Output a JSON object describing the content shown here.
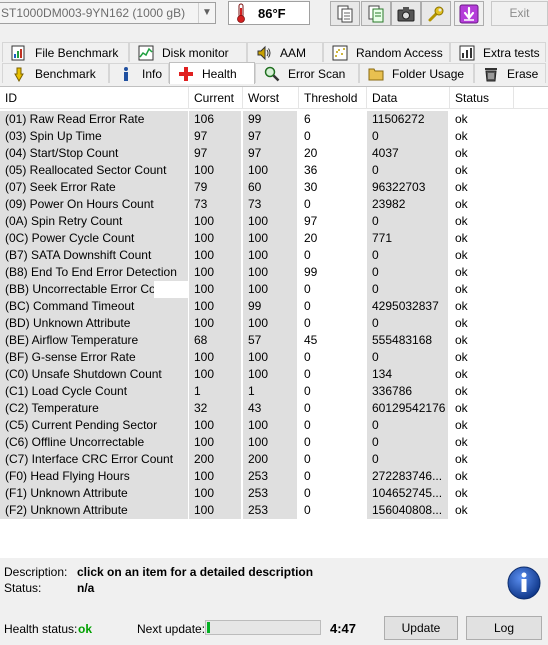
{
  "toolbar": {
    "drive": "ST1000DM003-9YN162 (1000 gB)",
    "temperature": "86°F",
    "exit_label": "Exit",
    "buttons": [
      "copy-icon",
      "copy-all-icon",
      "camera-icon",
      "wrench-icon",
      "download-icon"
    ],
    "colors": {
      "accent_purple": "#b43dd9",
      "thermo_red": "#d32020"
    }
  },
  "tabs_row1": [
    {
      "label": "File Benchmark",
      "icon": "file-benchmark-icon"
    },
    {
      "label": "Disk monitor",
      "icon": "disk-monitor-icon"
    },
    {
      "label": "AAM",
      "icon": "speaker-icon"
    },
    {
      "label": "Random Access",
      "icon": "random-access-icon"
    },
    {
      "label": "Extra tests",
      "icon": "extra-tests-icon"
    }
  ],
  "tabs_row2": [
    {
      "label": "Benchmark",
      "icon": "benchmark-icon"
    },
    {
      "label": "Info",
      "icon": "info-icon"
    },
    {
      "label": "Health",
      "icon": "health-icon",
      "active": true
    },
    {
      "label": "Error Scan",
      "icon": "magnifier-icon"
    },
    {
      "label": "Folder Usage",
      "icon": "folder-icon"
    },
    {
      "label": "Erase",
      "icon": "trash-icon"
    }
  ],
  "table": {
    "headers": {
      "id": "ID",
      "current": "Current",
      "worst": "Worst",
      "threshold": "Threshold",
      "data": "Data",
      "status": "Status"
    },
    "rows": [
      {
        "id": "(01) Raw Read Error Rate",
        "current": "106",
        "worst": "99",
        "threshold": "6",
        "data": "11506272",
        "status": "ok"
      },
      {
        "id": "(03) Spin Up Time",
        "current": "97",
        "worst": "97",
        "threshold": "0",
        "data": "0",
        "status": "ok"
      },
      {
        "id": "(04) Start/Stop Count",
        "current": "97",
        "worst": "97",
        "threshold": "20",
        "data": "4037",
        "status": "ok"
      },
      {
        "id": "(05) Reallocated Sector Count",
        "current": "100",
        "worst": "100",
        "threshold": "36",
        "data": "0",
        "status": "ok"
      },
      {
        "id": "(07) Seek Error Rate",
        "current": "79",
        "worst": "60",
        "threshold": "30",
        "data": "96322703",
        "status": "ok"
      },
      {
        "id": "(09) Power On Hours Count",
        "current": "73",
        "worst": "73",
        "threshold": "0",
        "data": "23982",
        "status": "ok"
      },
      {
        "id": "(0A) Spin Retry Count",
        "current": "100",
        "worst": "100",
        "threshold": "97",
        "data": "0",
        "status": "ok"
      },
      {
        "id": "(0C) Power Cycle Count",
        "current": "100",
        "worst": "100",
        "threshold": "20",
        "data": "771",
        "status": "ok"
      },
      {
        "id": "(B7) SATA Downshift Count",
        "current": "100",
        "worst": "100",
        "threshold": "0",
        "data": "0",
        "status": "ok"
      },
      {
        "id": "(B8) End To End Error Detection",
        "current": "100",
        "worst": "100",
        "threshold": "99",
        "data": "0",
        "status": "ok"
      },
      {
        "id": "(BB) Uncorrectable Error Count",
        "current": "100",
        "worst": "100",
        "threshold": "0",
        "data": "0",
        "status": "ok"
      },
      {
        "id": "(BC) Command Timeout",
        "current": "100",
        "worst": "99",
        "threshold": "0",
        "data": "4295032837",
        "status": "ok"
      },
      {
        "id": "(BD) Unknown Attribute",
        "current": "100",
        "worst": "100",
        "threshold": "0",
        "data": "0",
        "status": "ok"
      },
      {
        "id": "(BE) Airflow Temperature",
        "current": "68",
        "worst": "57",
        "threshold": "45",
        "data": "555483168",
        "status": "ok"
      },
      {
        "id": "(BF) G-sense Error Rate",
        "current": "100",
        "worst": "100",
        "threshold": "0",
        "data": "0",
        "status": "ok"
      },
      {
        "id": "(C0) Unsafe Shutdown Count",
        "current": "100",
        "worst": "100",
        "threshold": "0",
        "data": "134",
        "status": "ok"
      },
      {
        "id": "(C1) Load Cycle Count",
        "current": "1",
        "worst": "1",
        "threshold": "0",
        "data": "336786",
        "status": "ok"
      },
      {
        "id": "(C2) Temperature",
        "current": "32",
        "worst": "43",
        "threshold": "0",
        "data": "60129542176",
        "status": "ok"
      },
      {
        "id": "(C5) Current Pending Sector",
        "current": "100",
        "worst": "100",
        "threshold": "0",
        "data": "0",
        "status": "ok"
      },
      {
        "id": "(C6) Offline Uncorrectable",
        "current": "100",
        "worst": "100",
        "threshold": "0",
        "data": "0",
        "status": "ok"
      },
      {
        "id": "(C7) Interface CRC Error Count",
        "current": "200",
        "worst": "200",
        "threshold": "0",
        "data": "0",
        "status": "ok"
      },
      {
        "id": "(F0) Head Flying Hours",
        "current": "100",
        "worst": "253",
        "threshold": "0",
        "data": "272283746...",
        "status": "ok"
      },
      {
        "id": "(F1) Unknown Attribute",
        "current": "100",
        "worst": "253",
        "threshold": "0",
        "data": "104652745...",
        "status": "ok"
      },
      {
        "id": "(F2) Unknown Attribute",
        "current": "100",
        "worst": "253",
        "threshold": "0",
        "data": "156040808...",
        "status": "ok"
      }
    ]
  },
  "description": {
    "desc_label": "Description:",
    "desc_value": "click on an item for a detailed description",
    "status_label": "Status:",
    "status_value": "n/a"
  },
  "footer": {
    "health_label": "Health status:",
    "health_value": "ok",
    "next_update_label": "Next update:",
    "progress_fraction": 0.03,
    "countdown": "4:47",
    "update_label": "Update",
    "log_label": "Log"
  }
}
